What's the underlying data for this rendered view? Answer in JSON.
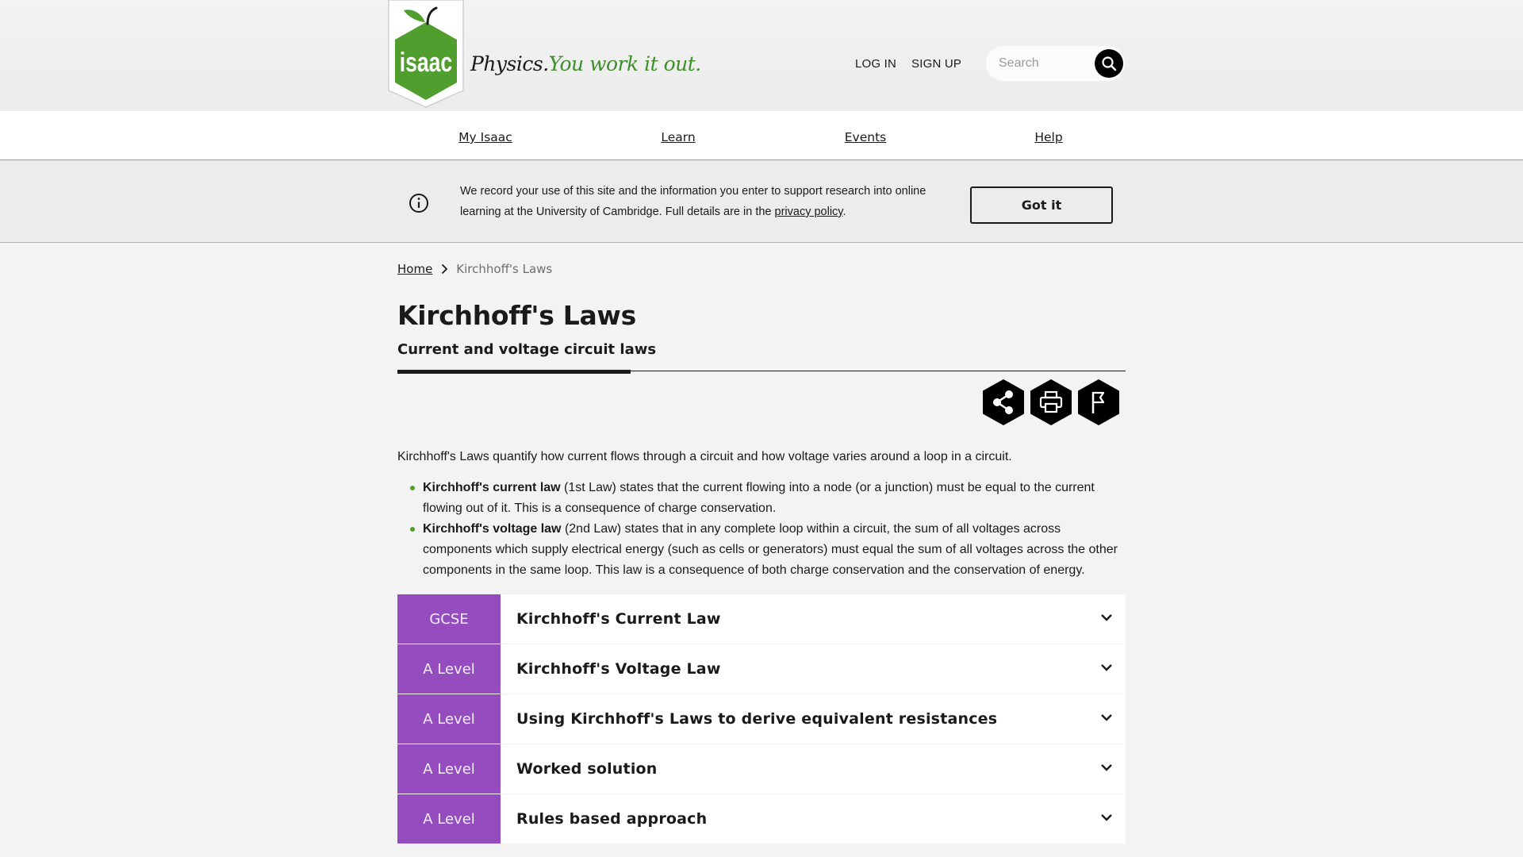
{
  "header": {
    "logo_text": "isaac",
    "tagline_part1": "Physics.",
    "tagline_part2": "You work it out.",
    "login_label": "LOG IN",
    "signup_label": "SIGN UP",
    "search": {
      "placeholder": "Search"
    }
  },
  "nav": {
    "items": [
      {
        "label": "My Isaac"
      },
      {
        "label": "Learn"
      },
      {
        "label": "Events"
      },
      {
        "label": "Help"
      }
    ]
  },
  "banner": {
    "text_before_link": "We record your use of this site and the information you enter to support research into online learning at the University of Cambridge. Full details are in the ",
    "link_label": "privacy policy",
    "text_after_link": ".",
    "button_label": "Got it"
  },
  "breadcrumb": {
    "home": "Home",
    "current": "Kirchhoff's Laws"
  },
  "page": {
    "title": "Kirchhoff's Laws",
    "subtitle": "Current and voltage circuit laws",
    "intro": "Kirchhoff's Laws quantify how current flows through a circuit and how voltage varies around a loop in a circuit.",
    "laws": [
      {
        "bold": "Kirchhoff's current law",
        "text": " (1st Law) states that the current flowing into a node (or a junction) must be equal to the current flowing out of it. This is a consequence of charge conservation."
      },
      {
        "bold": "Kirchhoff's voltage law",
        "text": " (2nd Law) states that in any complete loop within a circuit, the sum of all voltages across components which supply electrical energy (such as cells or generators) must equal the sum of all voltages across the other components in the same loop. This law is a consequence of both charge conservation and the conservation of energy."
      }
    ]
  },
  "actions": {
    "share_icon": "share-icon",
    "print_icon": "print-icon",
    "report_icon": "flag-icon"
  },
  "accordion": [
    {
      "level": "GCSE",
      "title": "Kirchhoff's Current Law"
    },
    {
      "level": "A Level",
      "title": "Kirchhoff's Voltage Law"
    },
    {
      "level": "A Level",
      "title": "Using Kirchhoff's Laws to derive equivalent resistances"
    },
    {
      "level": "A Level",
      "title": "Worked solution"
    },
    {
      "level": "A Level",
      "title": "Rules based approach"
    }
  ],
  "colors": {
    "brand_green": "#509e2e",
    "level_purple": "#944cbe"
  }
}
